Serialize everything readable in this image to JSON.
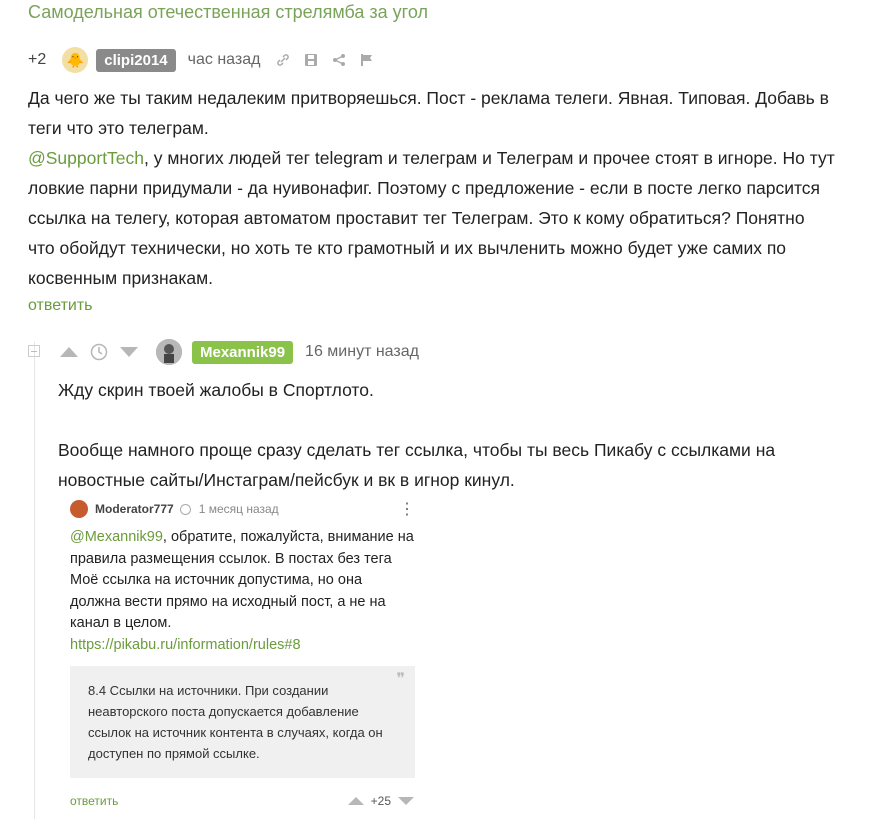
{
  "post": {
    "title": "Самодельная отечественная стрелямба за угол"
  },
  "comment1": {
    "rating": "+2",
    "username": "clipi2014",
    "time": "час назад",
    "text_line1": "Да чего же ты таким недалеким притворяешься. Пост - реклама телеги. Явная. Типовая. Добавь в",
    "text_line2": "теги что это телеграм.",
    "mention": "@SupportTech",
    "text_rest_line1": ", у многих людей тег telegram и телеграм и Телеграм и прочее стоят в игноре. Но тут",
    "text_line4": "ловкие парни придумали - да нуивонафиг. Поэтому с предложение - если в посте легко парсится",
    "text_line5": "ссылка на телегу, которая автоматом проставит тег Телеграм. Это к кому обратиться? Понятно",
    "text_line6": "что обойдут технически, но хоть те кто грамотный и их вычленить можно будет уже самих по",
    "text_line7": "косвенным признакам.",
    "reply_label": "ответить"
  },
  "comment2": {
    "username": "Mexannik99",
    "time": "16 минут назад",
    "para1": "Жду скрин твоей жалобы в Спортлото.",
    "para2_line1": "Вообще намного проще сразу сделать тег ссылка, чтобы ты весь Пикабу с ссылками на",
    "para2_line2": "новостные сайты/Инстаграм/пейсбук и вк в игнор кинул."
  },
  "embed": {
    "username": "Moderator777",
    "time": "1 месяц назад",
    "mention": "@Mexannik99",
    "msg_line1_rest": ", обратите, пожалуйста, внимание на",
    "msg_line2": "правила размещения ссылок. В постах без тега",
    "msg_line3": "Моё ссылка на источник допустима, но она",
    "msg_line4": "должна вести прямо на исходный пост, а не на",
    "msg_line5": "канал в целом.",
    "link": "https://pikabu.ru/information/rules#8",
    "quote_line1": "8.4 Ссылки на источники. При создании",
    "quote_line2": "неавторского поста допускается добавление",
    "quote_line3": "ссылок на источник контента в случаях, когда он",
    "quote_line4": "доступен по прямой ссылке.",
    "reply_label": "ответить",
    "score": "+25"
  },
  "colors": {
    "accent": "#6a9c3b",
    "badge_green": "#8bc34a",
    "badge_grey": "#8a8a8a"
  }
}
